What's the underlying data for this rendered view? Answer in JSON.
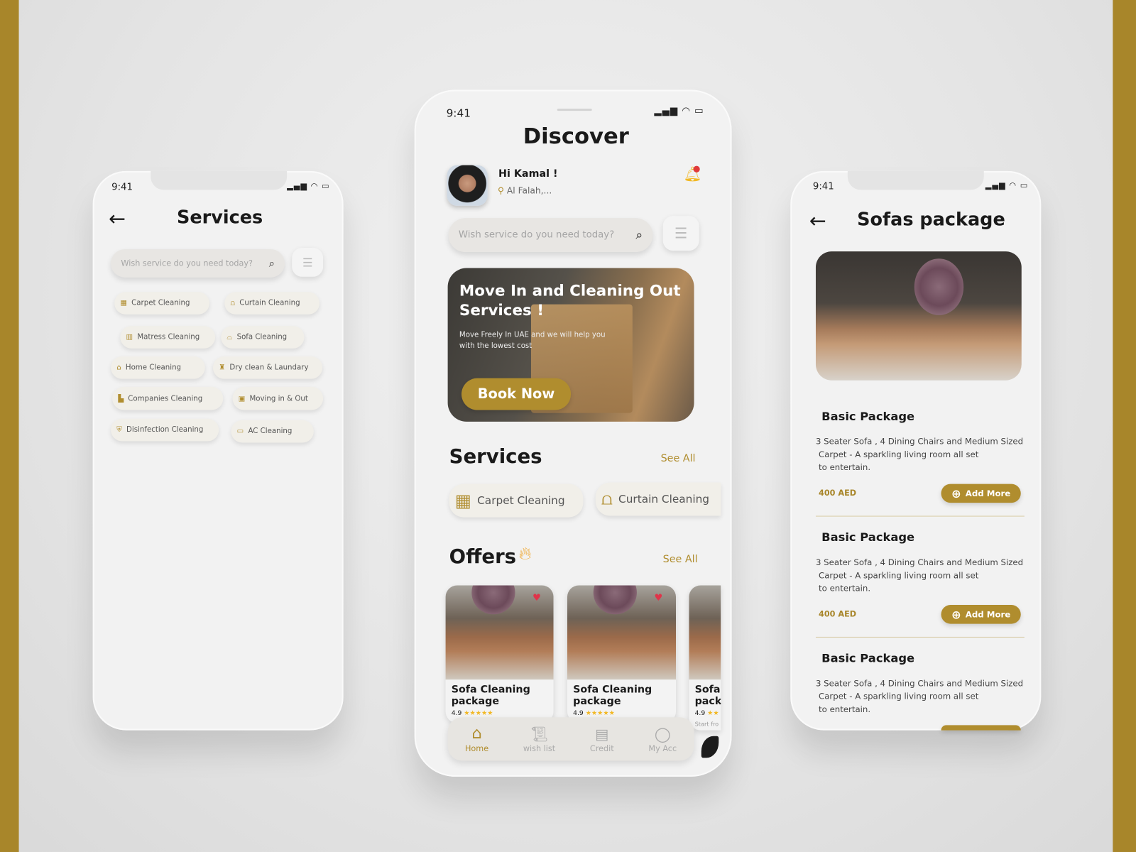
{
  "colors": {
    "accent": "#b08d2e",
    "frame": "#a8862a",
    "notification": "#e03a3a"
  },
  "status_time": "9:41",
  "left_phone": {
    "title": "Services",
    "search_placeholder": "Wish service do you need today?",
    "chips": [
      {
        "label": "Carpet Cleaning",
        "icon": "carpet-icon"
      },
      {
        "label": "Curtain Cleaning",
        "icon": "curtain-icon"
      },
      {
        "label": "Matress Cleaning",
        "icon": "mattress-icon"
      },
      {
        "label": "Sofa Cleaning",
        "icon": "sofa-icon"
      },
      {
        "label": "Home Cleaning",
        "icon": "home-icon"
      },
      {
        "label": "Dry clean & Laundary",
        "icon": "laundry-icon"
      },
      {
        "label": "Companies Cleaning",
        "icon": "buildings-icon"
      },
      {
        "label": "Moving in & Out",
        "icon": "box-icon"
      },
      {
        "label": "Disinfection Cleaning",
        "icon": "shield-icon"
      },
      {
        "label": "AC Cleaning",
        "icon": "ac-icon"
      }
    ]
  },
  "center_phone": {
    "title": "Discover",
    "greeting": "Hi Kamal !",
    "location": "Al Falah,...",
    "search_placeholder": "Wish service do you need today?",
    "banner": {
      "title_line1": "Move In and Cleaning Out",
      "title_line2": "Services !",
      "subtitle_line1": "Move Freely In UAE and we will help you",
      "subtitle_line2": "with the lowest cost",
      "button": "Book Now"
    },
    "services_heading": "Services",
    "services_see_all": "See All",
    "service_chips": [
      "Carpet Cleaning",
      "Curtain Cleaning"
    ],
    "offers_heading": "Offers",
    "offers_see_all": "See All",
    "offers": [
      {
        "title_line1": "Sofa Cleaning",
        "title_line2": "package",
        "rating": "4.9"
      },
      {
        "title_line1": "Sofa Cleaning",
        "title_line2": "package",
        "rating": "4.9"
      },
      {
        "title_line1": "Sofa",
        "title_line2": "pack",
        "rating": "4.9",
        "price_prefix": "Start fro"
      }
    ],
    "nav": [
      "Home",
      "wish list",
      "Credit",
      "My Acc"
    ],
    "nav_active": "Home"
  },
  "right_phone": {
    "title": "Sofas package",
    "packages": [
      {
        "title": "Basic Package",
        "desc1": "3 Seater Sofa , 4 Dining Chairs and Medium Sized",
        "desc2": "Carpet - A sparkling living room all set",
        "desc3": "to entertain.",
        "price": "400 AED",
        "button": "Add More"
      },
      {
        "title": "Basic Package",
        "desc1": "3 Seater Sofa , 4 Dining Chairs and Medium Sized",
        "desc2": "Carpet - A sparkling living room all set",
        "desc3": "to entertain.",
        "price": "400 AED",
        "button": "Add More"
      },
      {
        "title": "Basic Package",
        "desc1": "3 Seater Sofa , 4 Dining Chairs and Medium Sized",
        "desc2": "Carpet - A sparkling living room all set",
        "desc3": "to entertain."
      }
    ]
  }
}
